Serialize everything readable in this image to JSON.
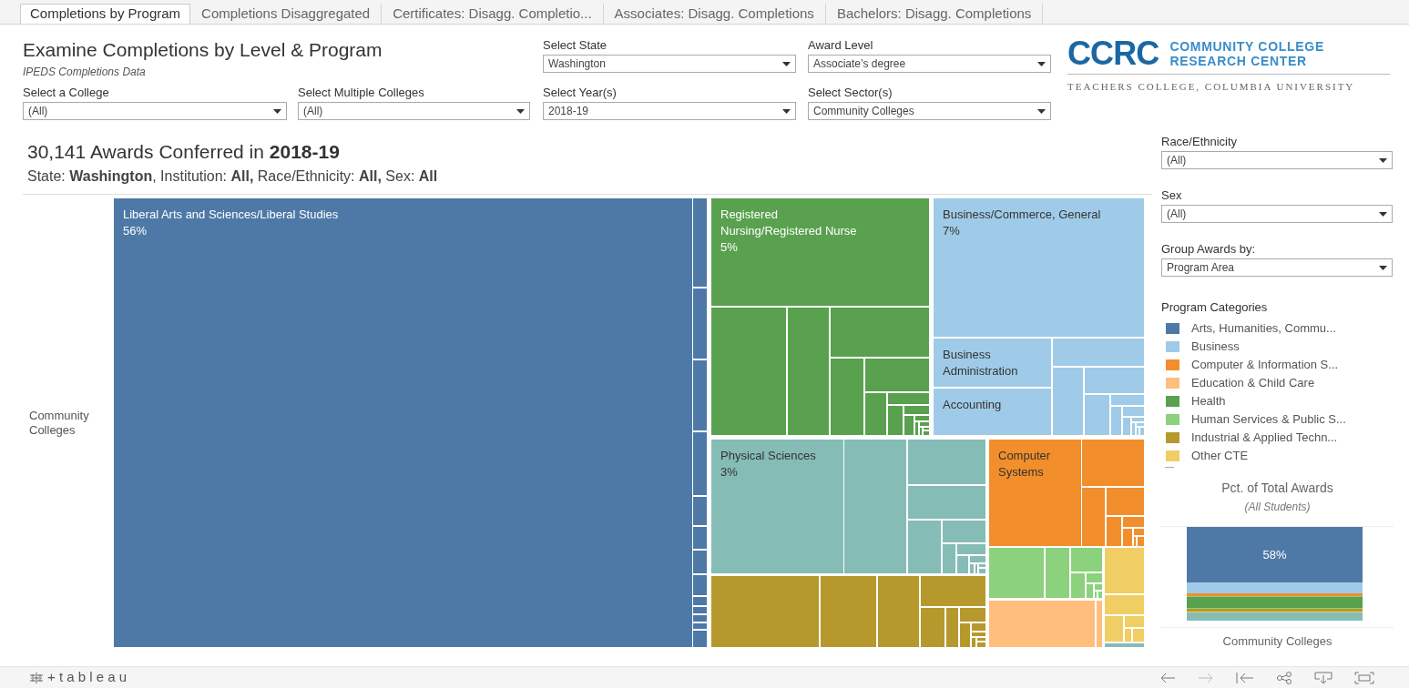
{
  "tabs": [
    {
      "label": "Completions by Program",
      "selected": true
    },
    {
      "label": "Completions Disaggregated",
      "selected": false
    },
    {
      "label": "Certificates: Disagg. Completio...",
      "selected": false
    },
    {
      "label": "Associates: Disagg. Completions",
      "selected": false
    },
    {
      "label": "Bachelors: Disagg. Completions",
      "selected": false
    }
  ],
  "header": {
    "title": "Examine Completions by Level & Program",
    "subtitle": "IPEDS Completions Data"
  },
  "filters": [
    {
      "label": "Select State",
      "value": "Washington"
    },
    {
      "label": "Award Level",
      "value": "Associate’s degree"
    },
    {
      "label": "Select a College",
      "value": "(All)"
    },
    {
      "label": "Select Multiple Colleges",
      "value": "(All)"
    },
    {
      "label": "Select Year(s)",
      "value": "2018-19"
    },
    {
      "label": "Select Sector(s)",
      "value": "Community Colleges"
    }
  ],
  "logo": {
    "mark": "CCRC",
    "name_line_1": "COMMUNITY COLLEGE",
    "name_line_2": "RESEARCH CENTER",
    "tagline": "TEACHERS COLLEGE, COLUMBIA UNIVERSITY"
  },
  "summary": {
    "headline": "30,141 Awards Conferred in **2018-19**",
    "details": "State: **Washington**, Institution: **All,** Race/Ethnicity: **All,** Sex: **All**"
  },
  "treemap": {
    "row_label": "Community Colleges",
    "tiles": [
      {
        "label": "Liberal Arts and Sciences/Liberal Studies",
        "percent": "56%",
        "color": "#4e79a7"
      },
      {
        "label": "Registered Nursing/Registered Nurse",
        "percent": "5%",
        "color": "#59a14f"
      },
      {
        "label": "Business/Commerce, General",
        "percent": "7%",
        "color": "#a0cbe8"
      },
      {
        "label": "Business Administration",
        "color": "#a0cbe8"
      },
      {
        "label": "Accounting",
        "color": "#a0cbe8"
      },
      {
        "label": "Physical Sciences",
        "percent": "3%",
        "color": "#86bcb6"
      },
      {
        "label": "Computer Systems",
        "color": "#f28e2b"
      }
    ]
  },
  "side_filters": [
    {
      "label": "Race/Ethnicity",
      "value": "(All)"
    },
    {
      "label": "Sex",
      "value": "(All)"
    },
    {
      "label": "Group Awards by:",
      "value": "Program Area"
    }
  ],
  "legend": {
    "title": "Program Categories",
    "items": [
      {
        "label": "Arts, Humanities, Commu...",
        "color": "#4e79a7"
      },
      {
        "label": "Business",
        "color": "#a0cbe8"
      },
      {
        "label": "Computer & Information S...",
        "color": "#f28e2b"
      },
      {
        "label": "Education & Child Care",
        "color": "#ffbe7d"
      },
      {
        "label": "Health",
        "color": "#59a14f"
      },
      {
        "label": "Human Services & Public S...",
        "color": "#8cd17d"
      },
      {
        "label": "Industrial & Applied Techn...",
        "color": "#b6992d"
      },
      {
        "label": "Other CTE",
        "color": "#f1ce63"
      }
    ]
  },
  "share_chart": {
    "title": "Pct. of Total Awards",
    "subtitle": "(All Students)",
    "segment_label": "58%",
    "category": "Community Colleges"
  },
  "footer": {
    "brand": "+ t a b l e a u"
  }
}
